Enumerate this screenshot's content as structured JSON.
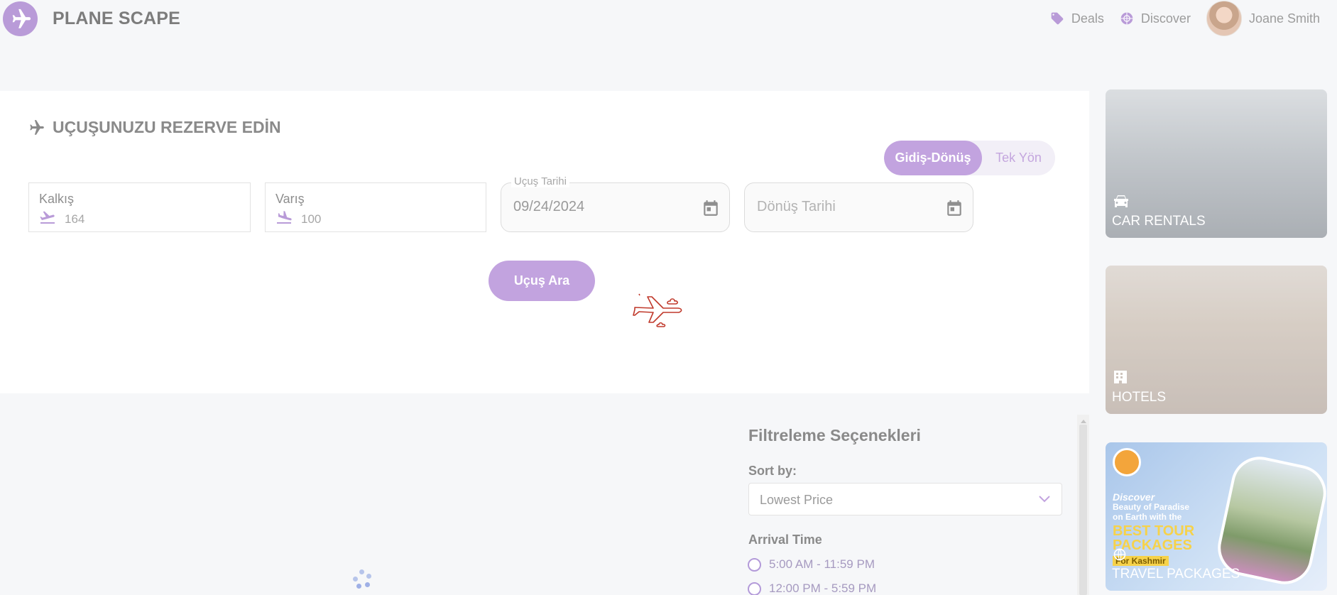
{
  "header": {
    "brand": "PLANE SCAPE",
    "nav": [
      {
        "label": "Deals",
        "icon": "tag-icon"
      },
      {
        "label": "Discover",
        "icon": "globe-icon"
      }
    ],
    "user_name": "Joane Smith"
  },
  "booking": {
    "title": "UÇUŞUNUZU REZERVE EDİN",
    "trip_types": [
      "Gidiş-Dönüş",
      "Tek Yön"
    ],
    "active_trip_type": "Gidiş-Dönüş",
    "departure": {
      "label": "Kalkış",
      "value": "164"
    },
    "arrival": {
      "label": "Varış",
      "value": "100"
    },
    "flight_date": {
      "label": "Uçuş Tarihi",
      "value": "09/24/2024"
    },
    "return_date": {
      "placeholder": "Dönüş Tarihi"
    },
    "search_label": "Uçuş Ara"
  },
  "filters": {
    "title": "Filtreleme Seçenekleri",
    "sort_label": "Sort by:",
    "sort_value": "Lowest Price",
    "arrival_time_label": "Arrival Time",
    "arrival_options": [
      "5:00 AM - 11:59 PM",
      "12:00 PM - 5:59 PM"
    ]
  },
  "promos": [
    {
      "label": "CAR RENTALS",
      "icon": "car-icon"
    },
    {
      "label": "HOTELS",
      "icon": "building-icon"
    },
    {
      "label": "TRAVEL PACKAGES",
      "icon": "globe-icon"
    }
  ],
  "travel_ad": {
    "line1": "Discover",
    "line2": "Beauty of Paradise",
    "line3": "on Earth with the",
    "big1": "BEST TOUR",
    "big2": "PACKAGES",
    "tag": "For Kashmir"
  },
  "colors": {
    "accent": "#c2a3df",
    "brand_purple": "#b99bd8",
    "loader_red": "#c0392b"
  }
}
